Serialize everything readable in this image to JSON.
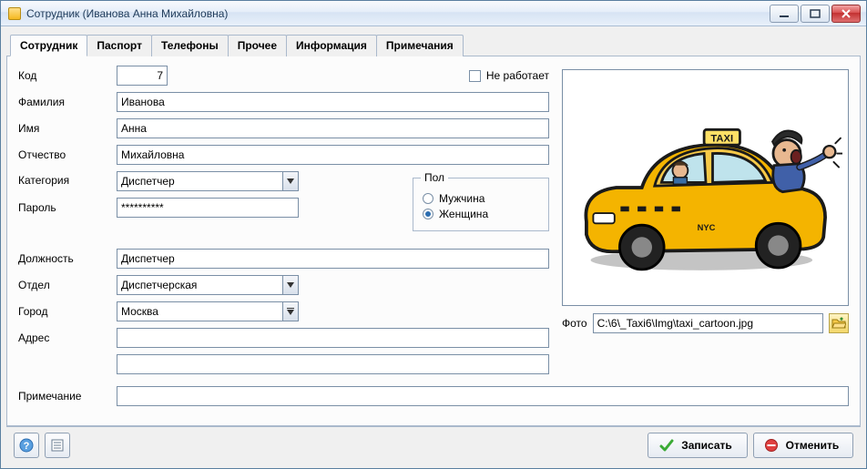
{
  "window": {
    "title": "Сотрудник  (Иванова Анна Михайловна)"
  },
  "tabs": [
    {
      "label": "Сотрудник",
      "active": true
    },
    {
      "label": "Паспорт",
      "active": false
    },
    {
      "label": "Телефоны",
      "active": false
    },
    {
      "label": "Прочее",
      "active": false
    },
    {
      "label": "Информация",
      "active": false
    },
    {
      "label": "Примечания",
      "active": false
    }
  ],
  "labels": {
    "code": "Код",
    "not_working": "Не работает",
    "surname": "Фамилия",
    "name": "Имя",
    "patronymic": "Отчество",
    "category": "Категория",
    "password": "Пароль",
    "gender_legend": "Пол",
    "gender_male": "Мужчина",
    "gender_female": "Женщина",
    "position": "Должность",
    "department": "Отдел",
    "city": "Город",
    "address": "Адрес",
    "photo": "Фото",
    "note": "Примечание"
  },
  "values": {
    "code": "7",
    "not_working_checked": false,
    "surname": "Иванова",
    "name": "Анна",
    "patronymic": "Михайловна",
    "category": "Диспетчер",
    "password": "**********",
    "gender": "female",
    "position": "Диспетчер",
    "department": "Диспетчерская",
    "city": "Москва",
    "address": "",
    "address2": "",
    "photo_path": "C:\\6\\_Taxi6\\Img\\taxi_cartoon.jpg",
    "note": ""
  },
  "buttons": {
    "save": "Записать",
    "cancel": "Отменить"
  },
  "icons": {
    "help": "help-icon",
    "list": "list-icon",
    "check": "check-icon",
    "stop": "stop-icon",
    "browse": "folder-open-icon"
  }
}
